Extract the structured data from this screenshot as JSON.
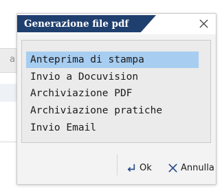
{
  "background": {
    "letter": "a"
  },
  "dialog": {
    "title": "Generazione file pdf",
    "options": [
      "Anteprima di stampa",
      "Invio a Docuvision",
      "Archiviazione PDF",
      "Archiviazione pratiche",
      "Invio Email"
    ],
    "selected_option": "Anteprima di stampa",
    "buttons": {
      "ok_label": "Ok",
      "cancel_label": "Annulla"
    }
  },
  "colors": {
    "title_bar": "#1f3f6e",
    "selection": "#a7cdf1"
  },
  "icons": {
    "close": "close-icon",
    "ok": "enter-arrow-icon",
    "cancel": "x-icon"
  }
}
